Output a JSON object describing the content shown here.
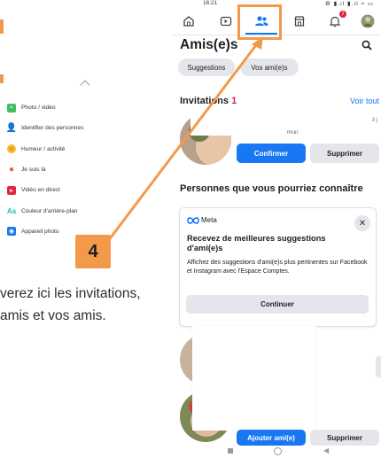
{
  "status_bar": {
    "time": "16:21"
  },
  "nav": {
    "items": [
      "home-icon",
      "video-icon",
      "friends-icon",
      "marketplace-icon",
      "notifications-icon",
      "profile-avatar"
    ],
    "notification_count": "2"
  },
  "left_menu": {
    "items": [
      {
        "label": "Photo / vidéo",
        "icon": "photo-icon",
        "color": "#45bd62"
      },
      {
        "label": "Identifier des personnes",
        "icon": "tag-people-icon",
        "color": "#1877f2"
      },
      {
        "label": "Humeur / activité",
        "icon": "feeling-icon",
        "color": "#f7b928"
      },
      {
        "label": "Je suis là",
        "icon": "location-icon",
        "color": "#f5533d"
      },
      {
        "label": "Vidéo en direct",
        "icon": "live-video-icon",
        "color": "#e42645"
      },
      {
        "label": "Couleur d'arrière-plan",
        "icon": "background-color-icon",
        "color": "#2abba7"
      },
      {
        "label": "Appareil photo",
        "icon": "camera-icon",
        "color": "#1877f2"
      }
    ]
  },
  "left_text": {
    "line1": "verez ici les invitations,",
    "line2": "amis et vos amis."
  },
  "friends": {
    "title": "Amis(e)s",
    "chips": [
      "Suggestions",
      "Vos ami(e)s"
    ],
    "invitations": {
      "title": "Invitations",
      "count": "1",
      "see_all": "Voir tout",
      "time": "3 j",
      "mutual": "mun",
      "confirm": "Confirmer",
      "delete": "Supprimer"
    },
    "suggestions_title": "Personnes que vous pourriez connaître",
    "meta_card": {
      "brand": "Meta",
      "title": "Recevez de meilleures suggestions d'ami(e)s",
      "description": "Affichez des suggestions d'ami(e)s plus pertinentes sur Facebook et Instagram avec l'Espace Comptes.",
      "button": "Continuer"
    },
    "suggestion_buttons": {
      "add": "Ajouter ami(e)",
      "remove": "Supprimer"
    }
  },
  "annotation": {
    "step": "4",
    "color": "#f39a4a"
  }
}
